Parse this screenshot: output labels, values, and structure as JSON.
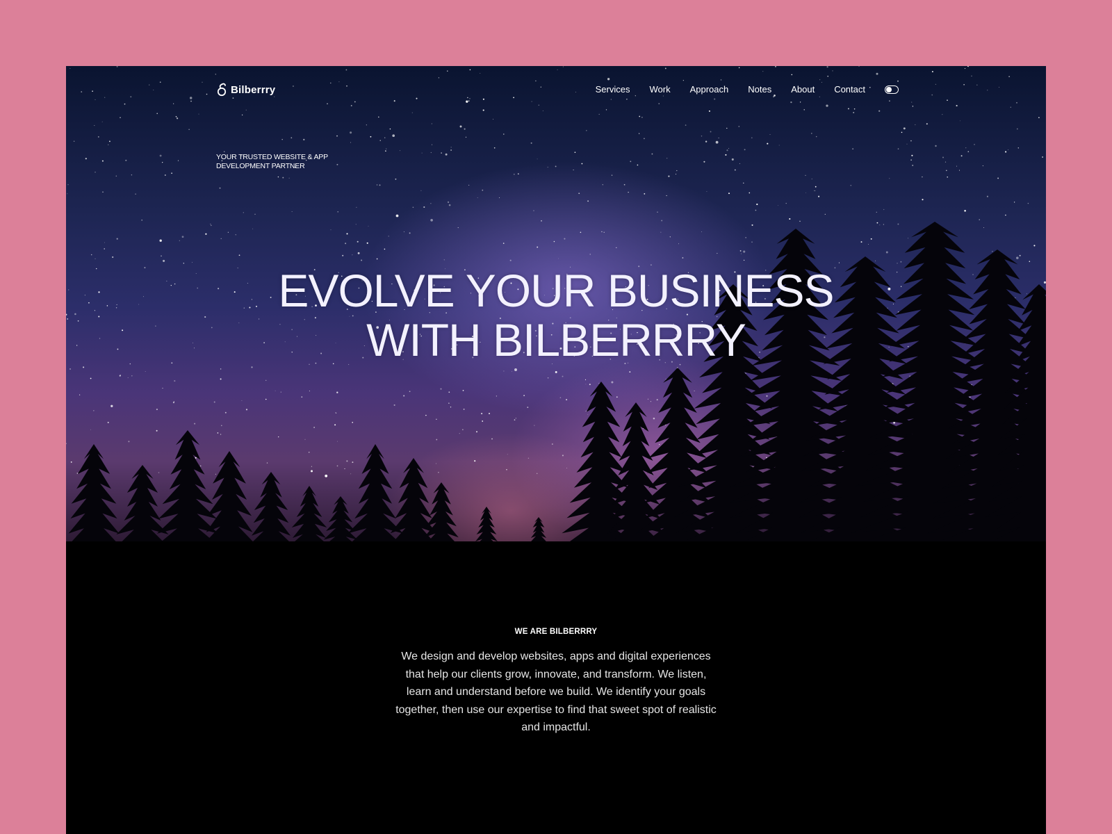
{
  "brand": {
    "name": "Bilberrry",
    "logo_icon": "berry-logo-icon"
  },
  "nav": {
    "items": [
      {
        "label": "Services"
      },
      {
        "label": "Work"
      },
      {
        "label": "Approach"
      },
      {
        "label": "Notes"
      },
      {
        "label": "About"
      },
      {
        "label": "Contact"
      }
    ],
    "theme_toggle_icon": "theme-toggle-icon"
  },
  "hero": {
    "tagline": "YOUR TRUSTED WEBSITE & APP DEVELOPMENT PARTNER",
    "headline": "EVOLVE YOUR BUSINESS\nWITH BILBERRRY",
    "background": "starry-night-sky-with-pine-tree-silhouettes"
  },
  "about": {
    "eyebrow": "WE ARE BILBERRRY",
    "body": "We design and develop websites, apps and digital experiences that help our clients grow, innovate, and transform. We listen, learn and understand before we build. We identify your goals together, then use our expertise to find that sweet spot of realistic and impactful."
  },
  "colors": {
    "page_background": "#dc8099",
    "site_background": "#000000",
    "text": "#ffffff"
  }
}
